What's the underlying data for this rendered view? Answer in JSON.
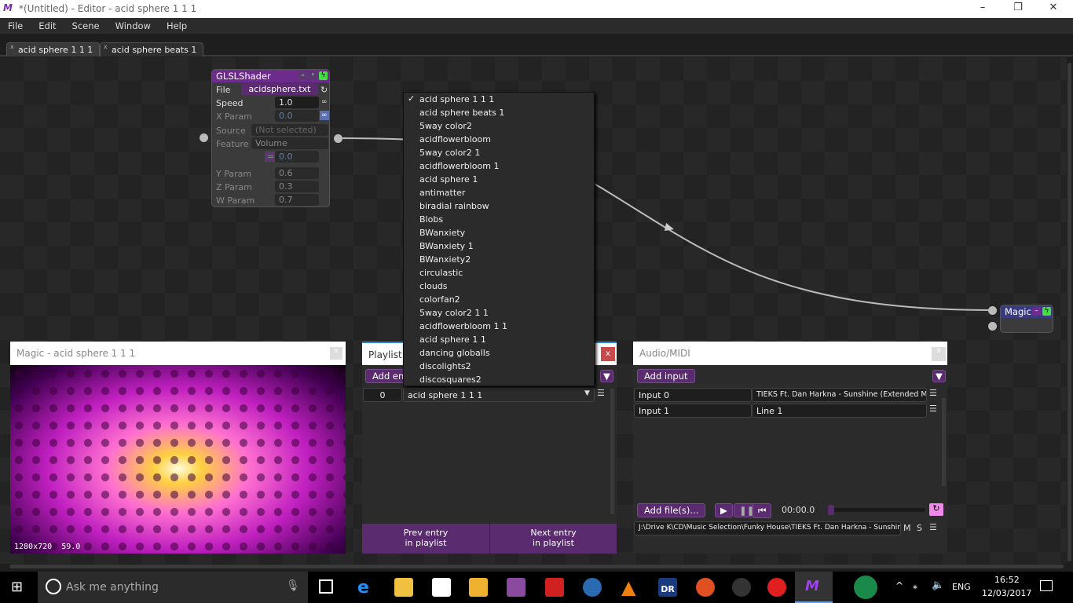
{
  "window": {
    "title": "*(Untitled) - Editor - acid sphere 1 1 1",
    "logo": "M",
    "minimize": "–",
    "maximize": "❐",
    "close": "✕"
  },
  "menu": [
    "File",
    "Edit",
    "Scene",
    "Window",
    "Help"
  ],
  "tabs": [
    {
      "label": "acid sphere 1 1 1",
      "close": "x"
    },
    {
      "label": "acid sphere beats 1",
      "close": "x"
    }
  ],
  "glsl_node": {
    "title": "GLSLShader",
    "file_label": "File",
    "file_value": "acidsphere.txt",
    "params": [
      {
        "label": "Speed",
        "value": "1.0"
      },
      {
        "label": "X Param",
        "value": "0.0"
      },
      {
        "label": "Source",
        "value": "(Not selected)"
      },
      {
        "label": "Feature",
        "value": "Volume"
      },
      {
        "label": "",
        "value": "0.0"
      },
      {
        "label": "Y Param",
        "value": "0.6"
      },
      {
        "label": "Z Param",
        "value": "0.3"
      },
      {
        "label": "W Param",
        "value": "0.7"
      }
    ]
  },
  "magic_node": {
    "title": "Magic"
  },
  "dropdown": {
    "selected": "acid sphere 1 1 1",
    "check": "✓",
    "items": [
      "acid sphere 1 1 1",
      "acid sphere beats 1",
      "5way color2",
      "acidflowerbloom",
      "5way color2 1",
      "acidflowerbloom 1",
      "acid sphere 1",
      "antimatter",
      "biradial rainbow",
      "Blobs",
      "BWanxiety",
      "BWanxiety 1",
      "BWanxiety2",
      "circulastic",
      "clouds",
      "colorfan2",
      "5way color2 1 1",
      "acidflowerbloom 1 1",
      "acid sphere 1 1",
      "dancing globalls",
      "discolights2",
      "discosquares2"
    ]
  },
  "preview": {
    "title": "Magic - acid sphere 1 1 1",
    "info": "1280x720  59.0",
    "close": "x"
  },
  "playlist": {
    "title": "Playlist",
    "close": "x",
    "add_entry": "Add entry",
    "entries": [
      {
        "index": "0",
        "scene": "acid sphere 1 1 1"
      }
    ],
    "prev": "Prev entry\nin playlist",
    "next": "Next entry\nin playlist"
  },
  "audio": {
    "title": "Audio/MIDI",
    "close": "x",
    "add_input": "Add input",
    "inputs": [
      {
        "name": "Input 0",
        "source": "TIEKS Ft. Dan Harkna - Sunshine (Extended Mix..."
      },
      {
        "name": "Input 1",
        "source": "Line 1"
      }
    ],
    "add_files": "Add file(s)...",
    "time": "00:00.0",
    "progress": 0,
    "file_path": "J:\\Drive K\\CD\\Music Selection\\Funky House\\TIEKS Ft. Dan Harkna - Sunshine (Exte...",
    "m": "M",
    "s": "S"
  },
  "taskbar": {
    "search_placeholder": "Ask me anything",
    "lang": "ENG",
    "time": "16:52",
    "date": "12/03/2017"
  },
  "colors": {
    "accent": "#6e2b8e",
    "green": "#44dd44",
    "close_red": "#c94a4a"
  }
}
